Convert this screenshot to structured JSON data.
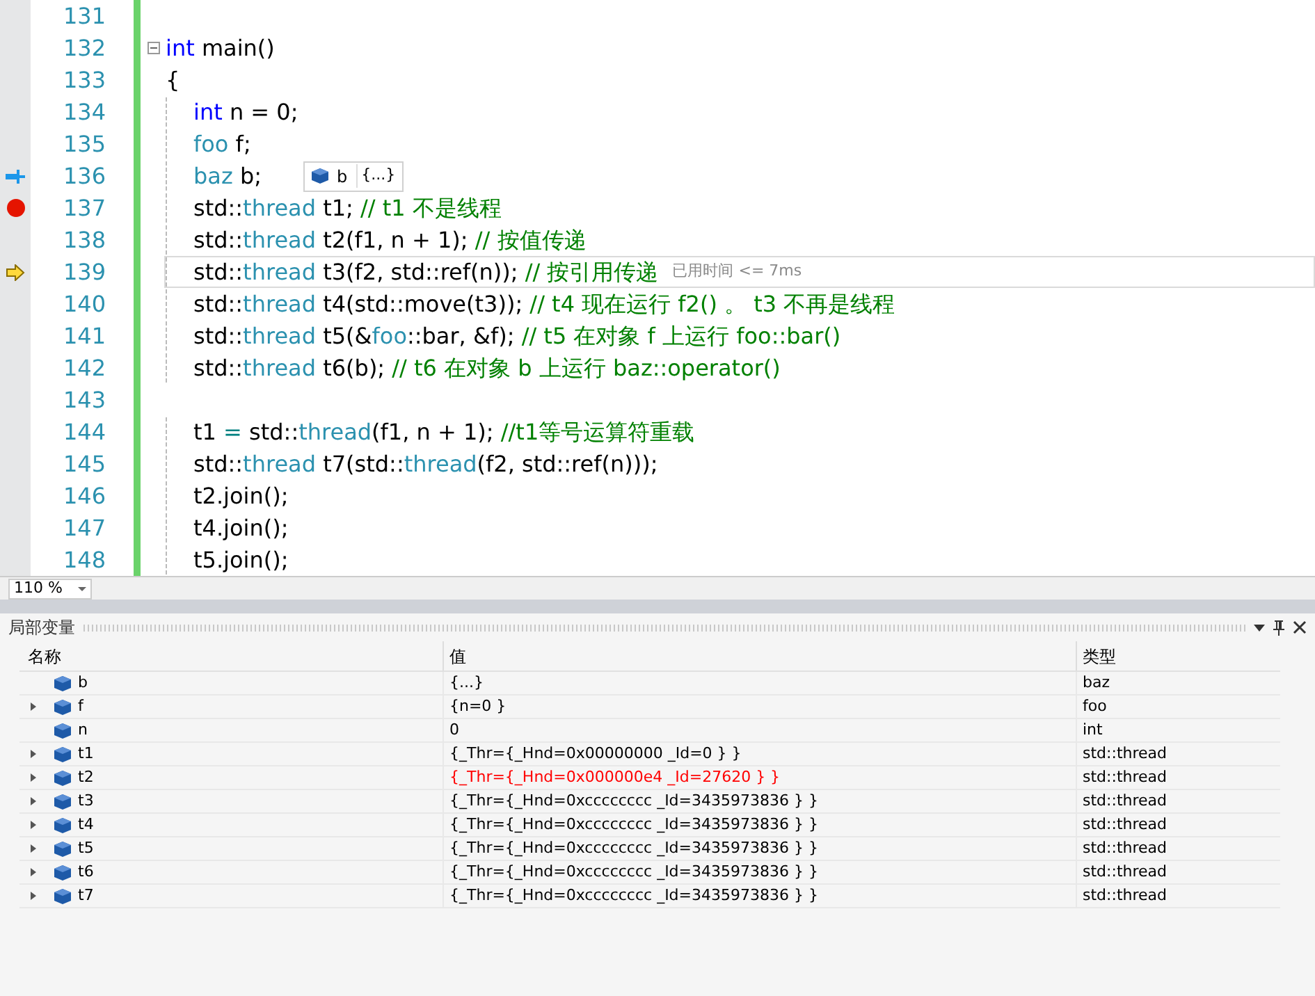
{
  "editor": {
    "lines": [
      {
        "number": "131",
        "indented": false
      },
      {
        "number": "132",
        "indented": false,
        "fold": true,
        "tokens": [
          {
            "kind": "keyword",
            "text": "int"
          },
          {
            "kind": "plain",
            "text": " main()"
          }
        ]
      },
      {
        "number": "133",
        "indented": false,
        "tokens": [
          {
            "kind": "plain",
            "text": "{"
          }
        ]
      },
      {
        "number": "134",
        "indented": true,
        "tokens": [
          {
            "kind": "keyword",
            "text": "int"
          },
          {
            "kind": "plain",
            "text": " n = 0;"
          }
        ]
      },
      {
        "number": "135",
        "indented": true,
        "tokens": [
          {
            "kind": "type",
            "text": "foo"
          },
          {
            "kind": "plain",
            "text": " f;"
          }
        ]
      },
      {
        "number": "136",
        "indented": true,
        "gutter_icon": {
          "kind": "bookmark"
        },
        "tokens": [
          {
            "kind": "type",
            "text": "baz"
          },
          {
            "kind": "plain",
            "text": " b;"
          }
        ],
        "datatip": {
          "name": "b",
          "value": "{...}"
        }
      },
      {
        "number": "137",
        "indented": true,
        "gutter_icon": {
          "kind": "breakpoint"
        },
        "tokens": [
          {
            "kind": "plain",
            "text": "std::"
          },
          {
            "kind": "type",
            "text": "thread"
          },
          {
            "kind": "plain",
            "text": " t1; "
          },
          {
            "kind": "comment",
            "text": "// t1 不是线程"
          }
        ]
      },
      {
        "number": "138",
        "indented": true,
        "tokens": [
          {
            "kind": "plain",
            "text": "std::"
          },
          {
            "kind": "type",
            "text": "thread"
          },
          {
            "kind": "plain",
            "text": " t2(f1, n + 1); "
          },
          {
            "kind": "comment",
            "text": "// 按值传递"
          }
        ]
      },
      {
        "number": "139",
        "indented": true,
        "current": true,
        "gutter_icon": {
          "kind": "current"
        },
        "tokens": [
          {
            "kind": "plain",
            "text": "std::"
          },
          {
            "kind": "type",
            "text": "thread"
          },
          {
            "kind": "plain",
            "text": " t3(f2, std::ref(n)); "
          },
          {
            "kind": "comment",
            "text": "// 按引用传递"
          }
        ],
        "perftip": "已用时间 <= 7ms"
      },
      {
        "number": "140",
        "indented": true,
        "tokens": [
          {
            "kind": "plain",
            "text": "std::"
          },
          {
            "kind": "type",
            "text": "thread"
          },
          {
            "kind": "plain",
            "text": " t4(std::move(t3)); "
          },
          {
            "kind": "comment",
            "text": "// t4 现在运行 f2() 。 t3 不再是线程"
          }
        ]
      },
      {
        "number": "141",
        "indented": true,
        "tokens": [
          {
            "kind": "plain",
            "text": "std::"
          },
          {
            "kind": "type",
            "text": "thread"
          },
          {
            "kind": "plain",
            "text": " t5(&"
          },
          {
            "kind": "type",
            "text": "foo"
          },
          {
            "kind": "plain",
            "text": "::bar, &f); "
          },
          {
            "kind": "comment",
            "text": "// t5 在对象 f 上运行 foo::bar()"
          }
        ]
      },
      {
        "number": "142",
        "indented": true,
        "tokens": [
          {
            "kind": "plain",
            "text": "std::"
          },
          {
            "kind": "type",
            "text": "thread"
          },
          {
            "kind": "plain",
            "text": " t6(b); "
          },
          {
            "kind": "comment",
            "text": "// t6 在对象 b 上运行 baz::operator()"
          }
        ]
      },
      {
        "number": "143",
        "indented": false
      },
      {
        "number": "144",
        "indented": true,
        "tokens": [
          {
            "kind": "plain",
            "text": "t1 "
          },
          {
            "kind": "operator",
            "text": "="
          },
          {
            "kind": "plain",
            "text": " std::"
          },
          {
            "kind": "type",
            "text": "thread"
          },
          {
            "kind": "plain",
            "text": "(f1, n + 1); "
          },
          {
            "kind": "comment",
            "text": "//t1等号运算符重载"
          }
        ]
      },
      {
        "number": "145",
        "indented": true,
        "tokens": [
          {
            "kind": "plain",
            "text": "std::"
          },
          {
            "kind": "type",
            "text": "thread"
          },
          {
            "kind": "plain",
            "text": " t7(std::"
          },
          {
            "kind": "type",
            "text": "thread"
          },
          {
            "kind": "plain",
            "text": "(f2, std::ref(n)));"
          }
        ]
      },
      {
        "number": "146",
        "indented": true,
        "tokens": [
          {
            "kind": "plain",
            "text": "t2.join();"
          }
        ]
      },
      {
        "number": "147",
        "indented": true,
        "tokens": [
          {
            "kind": "plain",
            "text": "t4.join();"
          }
        ]
      },
      {
        "number": "148",
        "indented": true,
        "tokens": [
          {
            "kind": "plain",
            "text": "t5.join();"
          }
        ]
      }
    ],
    "zoom": "110 %"
  },
  "locals": {
    "title": "局部变量",
    "columns": [
      "名称",
      "值",
      "类型"
    ],
    "rows": [
      {
        "name": "b",
        "value": "{...}",
        "type": "baz",
        "expandable": false,
        "changed": false
      },
      {
        "name": "f",
        "value": "{n=0 }",
        "type": "foo",
        "expandable": true,
        "changed": false
      },
      {
        "name": "n",
        "value": "0",
        "type": "int",
        "expandable": false,
        "changed": false
      },
      {
        "name": "t1",
        "value": "{_Thr={_Hnd=0x00000000 _Id=0 } }",
        "type": "std::thread",
        "expandable": true,
        "changed": false
      },
      {
        "name": "t2",
        "value": "{_Thr={_Hnd=0x000000e4 _Id=27620 } }",
        "type": "std::thread",
        "expandable": true,
        "changed": true
      },
      {
        "name": "t3",
        "value": "{_Thr={_Hnd=0xcccccccc _Id=3435973836 } }",
        "type": "std::thread",
        "expandable": true,
        "changed": false
      },
      {
        "name": "t4",
        "value": "{_Thr={_Hnd=0xcccccccc _Id=3435973836 } }",
        "type": "std::thread",
        "expandable": true,
        "changed": false
      },
      {
        "name": "t5",
        "value": "{_Thr={_Hnd=0xcccccccc _Id=3435973836 } }",
        "type": "std::thread",
        "expandable": true,
        "changed": false
      },
      {
        "name": "t6",
        "value": "{_Thr={_Hnd=0xcccccccc _Id=3435973836 } }",
        "type": "std::thread",
        "expandable": true,
        "changed": false
      },
      {
        "name": "t7",
        "value": "{_Thr={_Hnd=0xcccccccc _Id=3435973836 } }",
        "type": "std::thread",
        "expandable": true,
        "changed": false
      }
    ]
  }
}
